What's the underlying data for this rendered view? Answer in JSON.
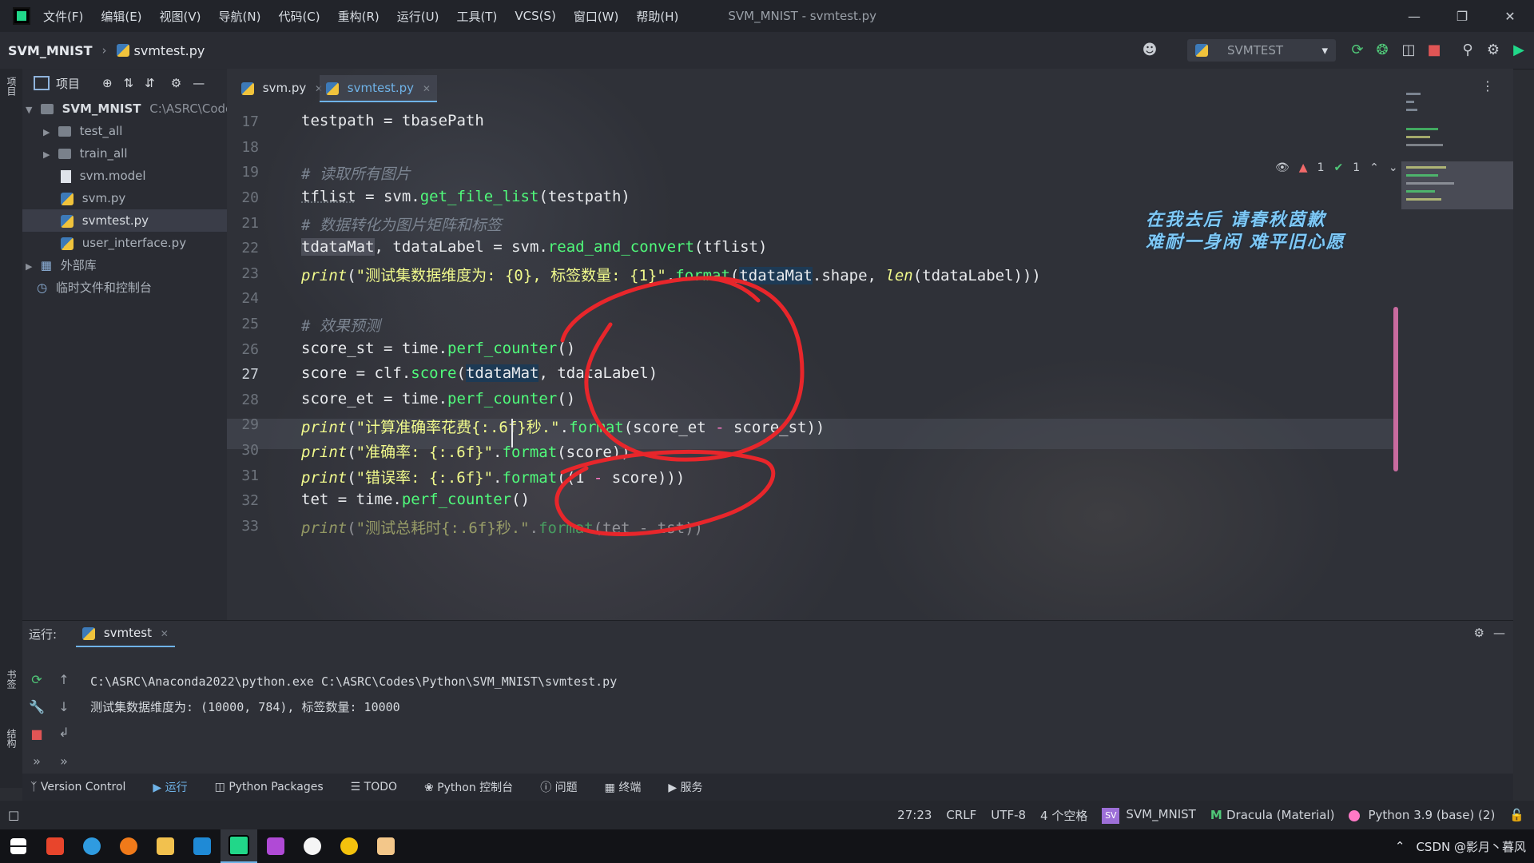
{
  "window": {
    "title": "SVM_MNIST - svmtest.py",
    "menu": [
      "文件(F)",
      "编辑(E)",
      "视图(V)",
      "导航(N)",
      "代码(C)",
      "重构(R)",
      "运行(U)",
      "工具(T)",
      "VCS(S)",
      "窗口(W)",
      "帮助(H)"
    ]
  },
  "breadcrumb": {
    "project": "SVM_MNIST",
    "file": "svmtest.py"
  },
  "run_config": {
    "name": "SVMTEST"
  },
  "left_strip": {
    "project": "项目",
    "bookmarks": "书签",
    "structure": "结构"
  },
  "project_panel": {
    "title": "项目",
    "root_name": "SVM_MNIST",
    "root_path": "C:\\ASRC\\Codes",
    "items": [
      "test_all",
      "train_all",
      "svm.model",
      "svm.py",
      "svmtest.py",
      "user_interface.py"
    ],
    "external_libs": "外部库",
    "scratches": "临时文件和控制台"
  },
  "tabs": [
    {
      "label": "svm.py"
    },
    {
      "label": "svmtest.py"
    }
  ],
  "inspections": {
    "warnings": "1",
    "ok": "1"
  },
  "editor": {
    "line_numbers": [
      "17",
      "18",
      "19",
      "20",
      "21",
      "22",
      "23",
      "24",
      "25",
      "26",
      "27",
      "28",
      "29",
      "30",
      "31",
      "32",
      "33"
    ],
    "current_line": "27",
    "poem": [
      "在我去后 请春秋茵歉",
      "难耐一身闲 难平旧心愿"
    ]
  },
  "code": {
    "l17": [
      "testpath = tbasePath"
    ],
    "l19": [
      "# 读取所有图片"
    ],
    "l20": [
      "tflist",
      " = svm.",
      "get_file_list",
      "(testpath)"
    ],
    "l21": [
      "# 数据转化为图片矩阵和标签"
    ],
    "l22": [
      "tdataMat",
      ", tdataLabel = svm.",
      "read_and_convert",
      "(tflist)"
    ],
    "l23": [
      "print",
      "(",
      "\"测试集数据维度为: {0}, 标签数量: {1}\"",
      ".",
      "format",
      "(",
      "tdataMat",
      ".shape, ",
      "len",
      "(tdataLabel)))"
    ],
    "l25": [
      "# 效果预测"
    ],
    "l26": [
      "score_st = time.",
      "perf_counter",
      "()"
    ],
    "l27": [
      "score = clf.",
      "score",
      "(",
      "tdataMat",
      ", tdataLabel)"
    ],
    "l28": [
      "score_et = time.",
      "perf_counter",
      "()"
    ],
    "l29": [
      "print",
      "(",
      "\"计算准确率花费{:.6f}秒.\"",
      ".",
      "format",
      "(score_et ",
      "-",
      " score_st))"
    ],
    "l30": [
      "print",
      "(",
      "\"准确率: {:.6f}\"",
      ".",
      "format",
      "(score))"
    ],
    "l31": [
      "print",
      "(",
      "\"错误率: {:.6f}\"",
      ".",
      "format",
      "((1 ",
      "-",
      " score)))"
    ],
    "l32": [
      "tet = time.",
      "perf_counter",
      "()"
    ],
    "l33": [
      "print",
      "(",
      "\"测试总耗时{:.6f}秒.\"",
      ".",
      "format",
      "(tet - tst))"
    ]
  },
  "run_panel": {
    "label": "运行:",
    "tab": "svmtest",
    "console": [
      "C:\\ASRC\\Anaconda2022\\python.exe C:\\ASRC\\Codes\\Python\\SVM_MNIST\\svmtest.py",
      "测试集数据维度为: (10000, 784), 标签数量: 10000"
    ]
  },
  "tool_windows": [
    "Version Control",
    "运行",
    "Python Packages",
    "TODO",
    "Python 控制台",
    "问题",
    "终端",
    "服务"
  ],
  "status": {
    "position": "27:23",
    "line_sep": "CRLF",
    "encoding": "UTF-8",
    "indent": "4 个空格",
    "badge": "SV",
    "project": "SVM_MNIST",
    "theme": "Dracula (Material)",
    "interpreter": "Python 3.9 (base) (2)"
  },
  "tray": {
    "text": "CSDN @影月丶暮风"
  },
  "colors": {
    "accent": "#6fb3e8",
    "fn": "#50fa7b",
    "string": "#f1fa8c",
    "annotation": "#e8262b"
  }
}
